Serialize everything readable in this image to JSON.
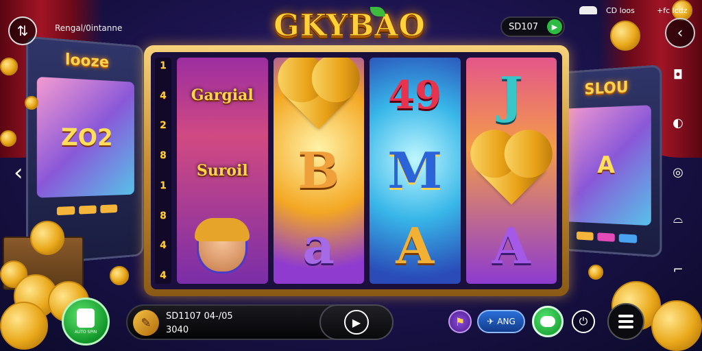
{
  "game": {
    "title": "GKYBAO"
  },
  "header": {
    "back_icon": "swap-arrows-icon",
    "label": "Rengal/0intanne",
    "balance": "SD107",
    "status_center": "CD loos",
    "status_right": "+fc lcdz"
  },
  "left_machine": {
    "title": "looze",
    "display": "ZO2"
  },
  "right_machine": {
    "title": "SLOU",
    "display": "A"
  },
  "paylines": [
    "1",
    "4",
    "2",
    "8",
    "1",
    "8",
    "4",
    "4"
  ],
  "reels": [
    {
      "symbols": [
        {
          "type": "word",
          "text": "Gargial"
        },
        {
          "type": "word",
          "text": "Suroil"
        },
        {
          "type": "character",
          "text": ""
        }
      ]
    },
    {
      "symbols": [
        {
          "type": "heart",
          "text": ""
        },
        {
          "type": "letter",
          "text": "B"
        },
        {
          "type": "letter",
          "text": "a"
        }
      ]
    },
    {
      "symbols": [
        {
          "type": "letter",
          "text": "49"
        },
        {
          "type": "letter",
          "text": "M"
        },
        {
          "type": "letter",
          "text": "A"
        }
      ]
    },
    {
      "symbols": [
        {
          "type": "letter",
          "text": "J"
        },
        {
          "type": "heart",
          "text": ""
        },
        {
          "type": "letter",
          "text": "A"
        }
      ]
    }
  ],
  "bottom": {
    "bet_line1": "SD1107 04-/05",
    "bet_line2": "3040",
    "spin_label": "AUTO SPIN",
    "share_label": "ANG",
    "play_icon": "play-icon"
  },
  "right_toolbar": [
    "camera-icon",
    "compass-icon",
    "aperture-icon",
    "helmet-icon",
    "corner-icon"
  ],
  "colors": {
    "gold": "#ffd23a",
    "green": "#12962a",
    "frame": "#c48a2f",
    "background": "#1d1450"
  }
}
